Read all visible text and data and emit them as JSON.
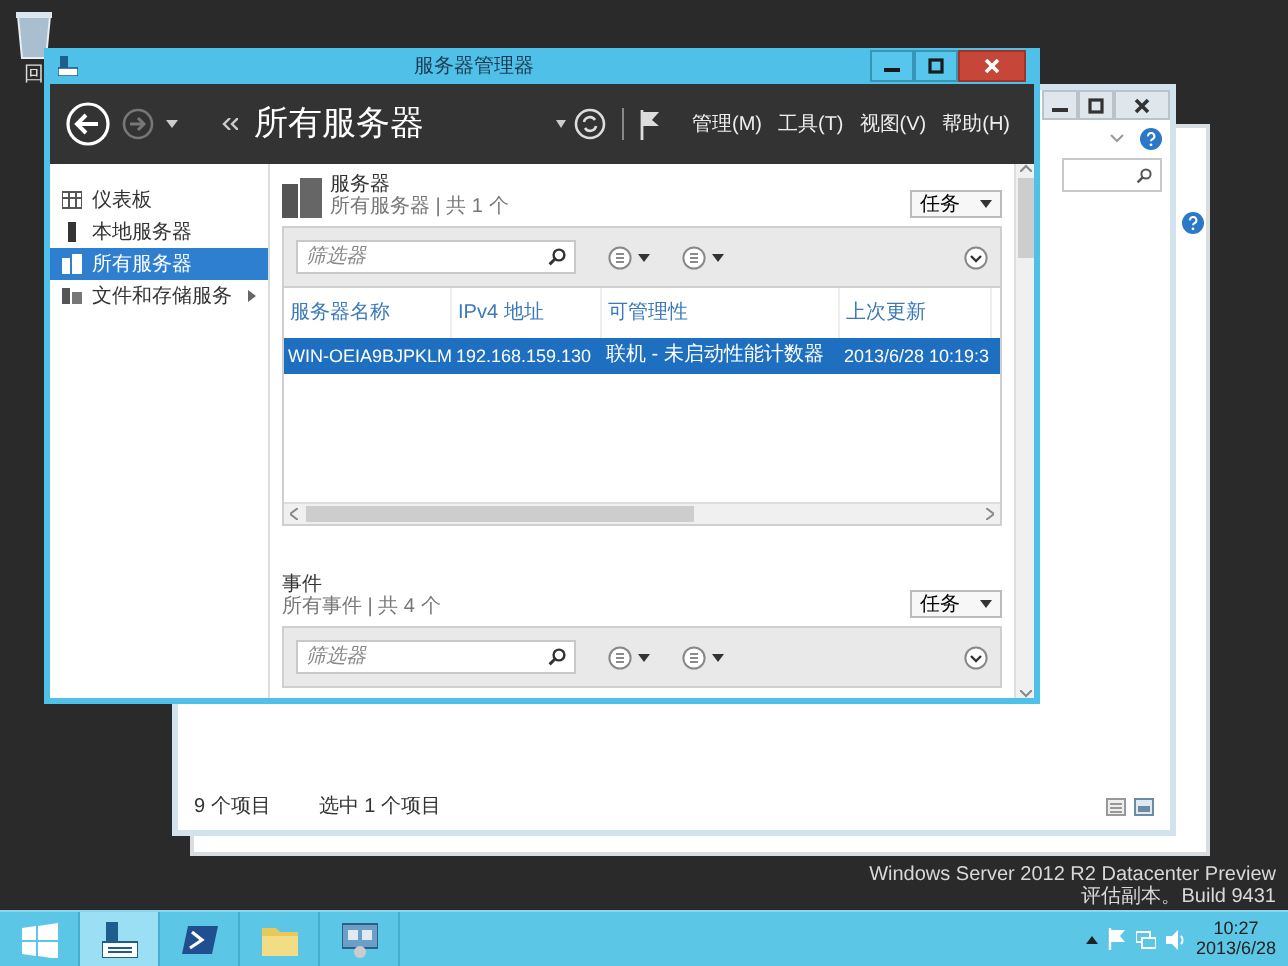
{
  "desktop": {
    "recycle_bin_label": "回",
    "edition_lines": [
      "Windows Server 2012 R2 Datacenter Preview",
      "评估副本。Build 9431"
    ]
  },
  "back_window": {
    "status_items": [
      "9 个项目",
      "选中 1 个项目"
    ]
  },
  "window": {
    "title": "服务器管理器",
    "breadcrumb": "所有服务器",
    "menus": [
      "管理(M)",
      "工具(T)",
      "视图(V)",
      "帮助(H)"
    ]
  },
  "sidebar": {
    "items": [
      {
        "label": "仪表板",
        "kind": "dashboard",
        "selected": false,
        "expandable": false
      },
      {
        "label": "本地服务器",
        "kind": "server",
        "selected": false,
        "expandable": false
      },
      {
        "label": "所有服务器",
        "kind": "servers",
        "selected": true,
        "expandable": false
      },
      {
        "label": "文件和存储服务",
        "kind": "storage",
        "selected": false,
        "expandable": true
      }
    ]
  },
  "servers": {
    "title": "服务器",
    "subtitle": "所有服务器 | 共 1 个",
    "tasks_button": "任务",
    "filter_placeholder": "筛选器",
    "columns": [
      "服务器名称",
      "IPv4 地址",
      "可管理性",
      "上次更新"
    ],
    "rows": [
      {
        "cells": [
          "WIN-OEIA9BJPKLM",
          "192.168.159.130",
          "联机 - 未启动性能计数器",
          "2013/6/28 10:19:3"
        ],
        "selected": true
      }
    ]
  },
  "events": {
    "title": "事件",
    "subtitle": "所有事件 | 共 4 个",
    "tasks_button": "任务",
    "filter_placeholder": "筛选器"
  },
  "taskbar": {
    "items": [
      {
        "kind": "start",
        "selected": false
      },
      {
        "kind": "server-manager",
        "selected": true
      },
      {
        "kind": "powershell",
        "selected": false
      },
      {
        "kind": "explorer",
        "selected": false
      },
      {
        "kind": "network",
        "selected": false
      }
    ]
  },
  "clock": {
    "time": "10:27",
    "date": "2013/6/28"
  }
}
